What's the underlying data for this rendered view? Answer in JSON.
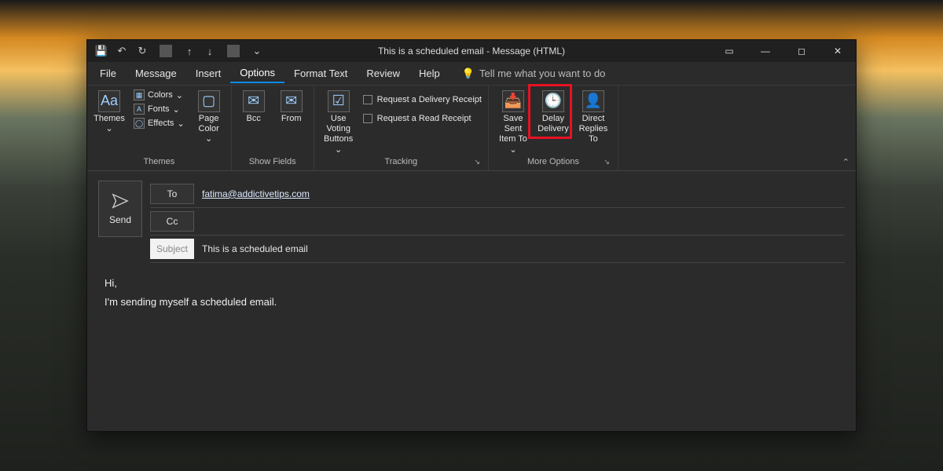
{
  "window": {
    "title": "This is a scheduled email - Message (HTML)"
  },
  "qat": {
    "save": "💾",
    "undo": "↶",
    "redo": "↻",
    "up": "↑",
    "down": "↓",
    "more": "⌄"
  },
  "menu": {
    "file": "File",
    "message": "Message",
    "insert": "Insert",
    "options": "Options",
    "format_text": "Format Text",
    "review": "Review",
    "help": "Help",
    "tellme": "Tell me what you want to do"
  },
  "ribbon": {
    "themes_group": {
      "label": "Themes",
      "themes_btn": "Themes",
      "colors": "Colors",
      "fonts": "Fonts",
      "effects": "Effects",
      "page_color": "Page Color"
    },
    "show_fields_group": {
      "label": "Show Fields",
      "bcc": "Bcc",
      "from": "From"
    },
    "tracking_group": {
      "label": "Tracking",
      "voting": "Use Voting Buttons",
      "delivery_receipt": "Request a Delivery Receipt",
      "read_receipt": "Request a Read Receipt"
    },
    "more_group": {
      "label": "More Options",
      "save_sent": "Save Sent Item To",
      "delay": "Delay Delivery",
      "direct": "Direct Replies To"
    }
  },
  "compose": {
    "send": "Send",
    "to_btn": "To",
    "to_value": "fatima@addictivetips.com",
    "cc_btn": "Cc",
    "cc_value": "",
    "subject_label": "Subject",
    "subject_value": "This is a scheduled email",
    "body_line1": "Hi,",
    "body_line2": "I'm sending myself a scheduled email."
  }
}
